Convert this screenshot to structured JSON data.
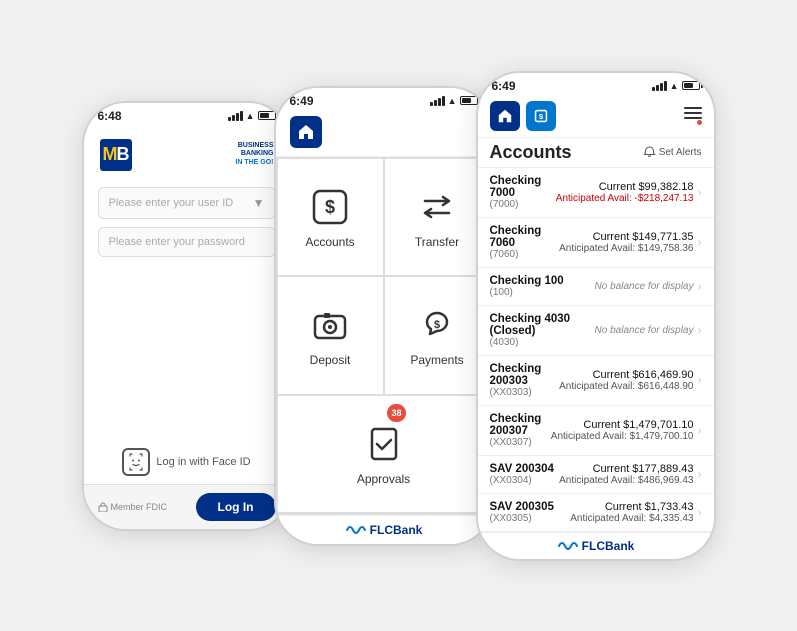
{
  "phones": {
    "phone1": {
      "time": "6:48",
      "logo_m": "M",
      "logo_b": "B",
      "tagline_line1": "BUSINESS",
      "tagline_line2": "BANKING",
      "tagline_line3": "IN THE GO!",
      "input_userid": "Please enter your user ID",
      "input_password": "Please enter your password",
      "face_id_label": "Log in with Face ID",
      "fdic_label": "Member FDIC",
      "login_btn": "Log In"
    },
    "phone2": {
      "time": "6:49",
      "menu_items": [
        {
          "label": "Accounts",
          "icon": "dollar-square"
        },
        {
          "label": "Transfer",
          "icon": "transfer"
        },
        {
          "label": "Deposit",
          "icon": "camera"
        },
        {
          "label": "Payments",
          "icon": "hand-dollar"
        },
        {
          "label": "Approvals",
          "icon": "check-doc",
          "badge": "38",
          "wide": true
        }
      ],
      "footer": "FLCBank"
    },
    "phone3": {
      "time": "6:49",
      "title": "Accounts",
      "set_alerts": "Set Alerts",
      "accounts": [
        {
          "name": "Checking 7000",
          "num": "(7000)",
          "current": "Current $99,382.18",
          "avail": "Anticipated Avail: -$218,247.13",
          "avail_neg": true
        },
        {
          "name": "Checking 7060",
          "num": "(7060)",
          "current": "Current $149,771.35",
          "avail": "Anticipated Avail: $149,758.36",
          "avail_neg": false
        },
        {
          "name": "Checking 100",
          "num": "(100)",
          "no_balance": "No balance for display"
        },
        {
          "name": "Checking 4030 (Closed)",
          "num": "(4030)",
          "no_balance": "No balance for display"
        },
        {
          "name": "Checking 200303",
          "num": "(XX0303)",
          "current": "Current $616,469.90",
          "avail": "Anticipated Avail: $616,448.90",
          "avail_neg": false
        },
        {
          "name": "Checking 200307",
          "num": "(XX0307)",
          "current": "Current $1,479,701.10",
          "avail": "Anticipated Avail: $1,479,700.10",
          "avail_neg": false
        },
        {
          "name": "SAV 200304",
          "num": "(XX0304)",
          "current": "Current $177,889.43",
          "avail": "Anticipated Avail: $486,969.43",
          "avail_neg": false
        },
        {
          "name": "SAV 200305",
          "num": "(XX0305)",
          "current": "Current $1,733.43",
          "avail": "Anticipated Avail: $4,335.43",
          "avail_neg": false
        }
      ],
      "footer": "FLCBank"
    }
  }
}
